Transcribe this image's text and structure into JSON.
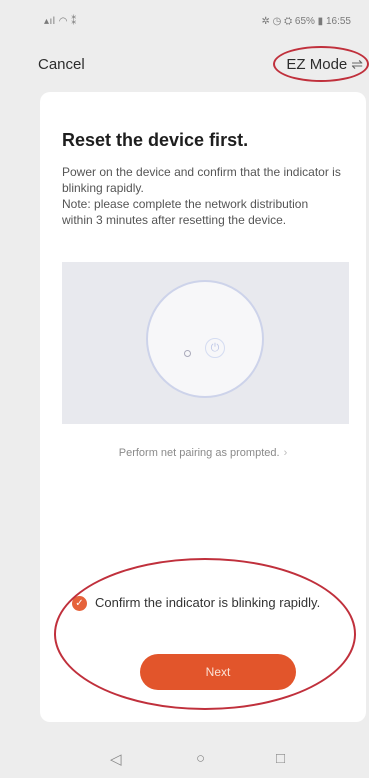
{
  "status_bar": {
    "left": "    ",
    "right": "     65%   16:55"
  },
  "header": {
    "cancel_label": "Cancel",
    "mode_label": "EZ Mode",
    "mode_icon": "swap-icon"
  },
  "card": {
    "title": "Reset the device first.",
    "description": [
      "Power on the device and confirm that the indicator is blinking rapidly.",
      "Note: please complete the network distribution within 3 minutes after resetting the device."
    ],
    "prompt_link": "Perform net pairing as prompted.",
    "confirm_text": "Confirm the indicator is blinking rapidly.",
    "next_label": "Next"
  },
  "nav_bar": {
    "back_icon": "back-triangle-icon",
    "home_icon": "home-circle-icon",
    "recent_icon": "recent-square-icon"
  },
  "colors": {
    "accent": "#e2552b",
    "annotation": "#c0303c"
  }
}
